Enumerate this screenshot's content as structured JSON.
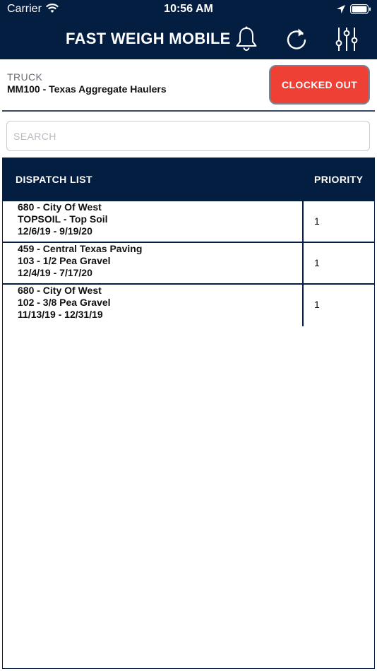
{
  "status_bar": {
    "carrier": "Carrier",
    "time": "10:56 AM"
  },
  "nav": {
    "title": "FAST WEIGH MOBILE"
  },
  "truck": {
    "label": "TRUCK",
    "value": "MM100 - Texas Aggregate Haulers"
  },
  "clock_button": {
    "label": "CLOCKED OUT"
  },
  "search": {
    "placeholder": "SEARCH",
    "value": ""
  },
  "table": {
    "columns": [
      "DISPATCH LIST",
      "PRIORITY"
    ],
    "rows": [
      {
        "line1": "680 - City Of West",
        "line2": "TOPSOIL - Top Soil",
        "line3": "12/6/19 - 9/19/20",
        "priority": "1"
      },
      {
        "line1": "459 - Central Texas Paving",
        "line2": "103 - 1/2 Pea Gravel",
        "line3": "12/4/19 - 7/17/20",
        "priority": "1"
      },
      {
        "line1": "680 - City Of West",
        "line2": "102 - 3/8 Pea Gravel",
        "line3": "11/13/19 - 12/31/19",
        "priority": "1"
      }
    ]
  },
  "colors": {
    "header_bg": "#041e42",
    "button_red": "#ee4035",
    "label_gray": "#6a6f78"
  }
}
